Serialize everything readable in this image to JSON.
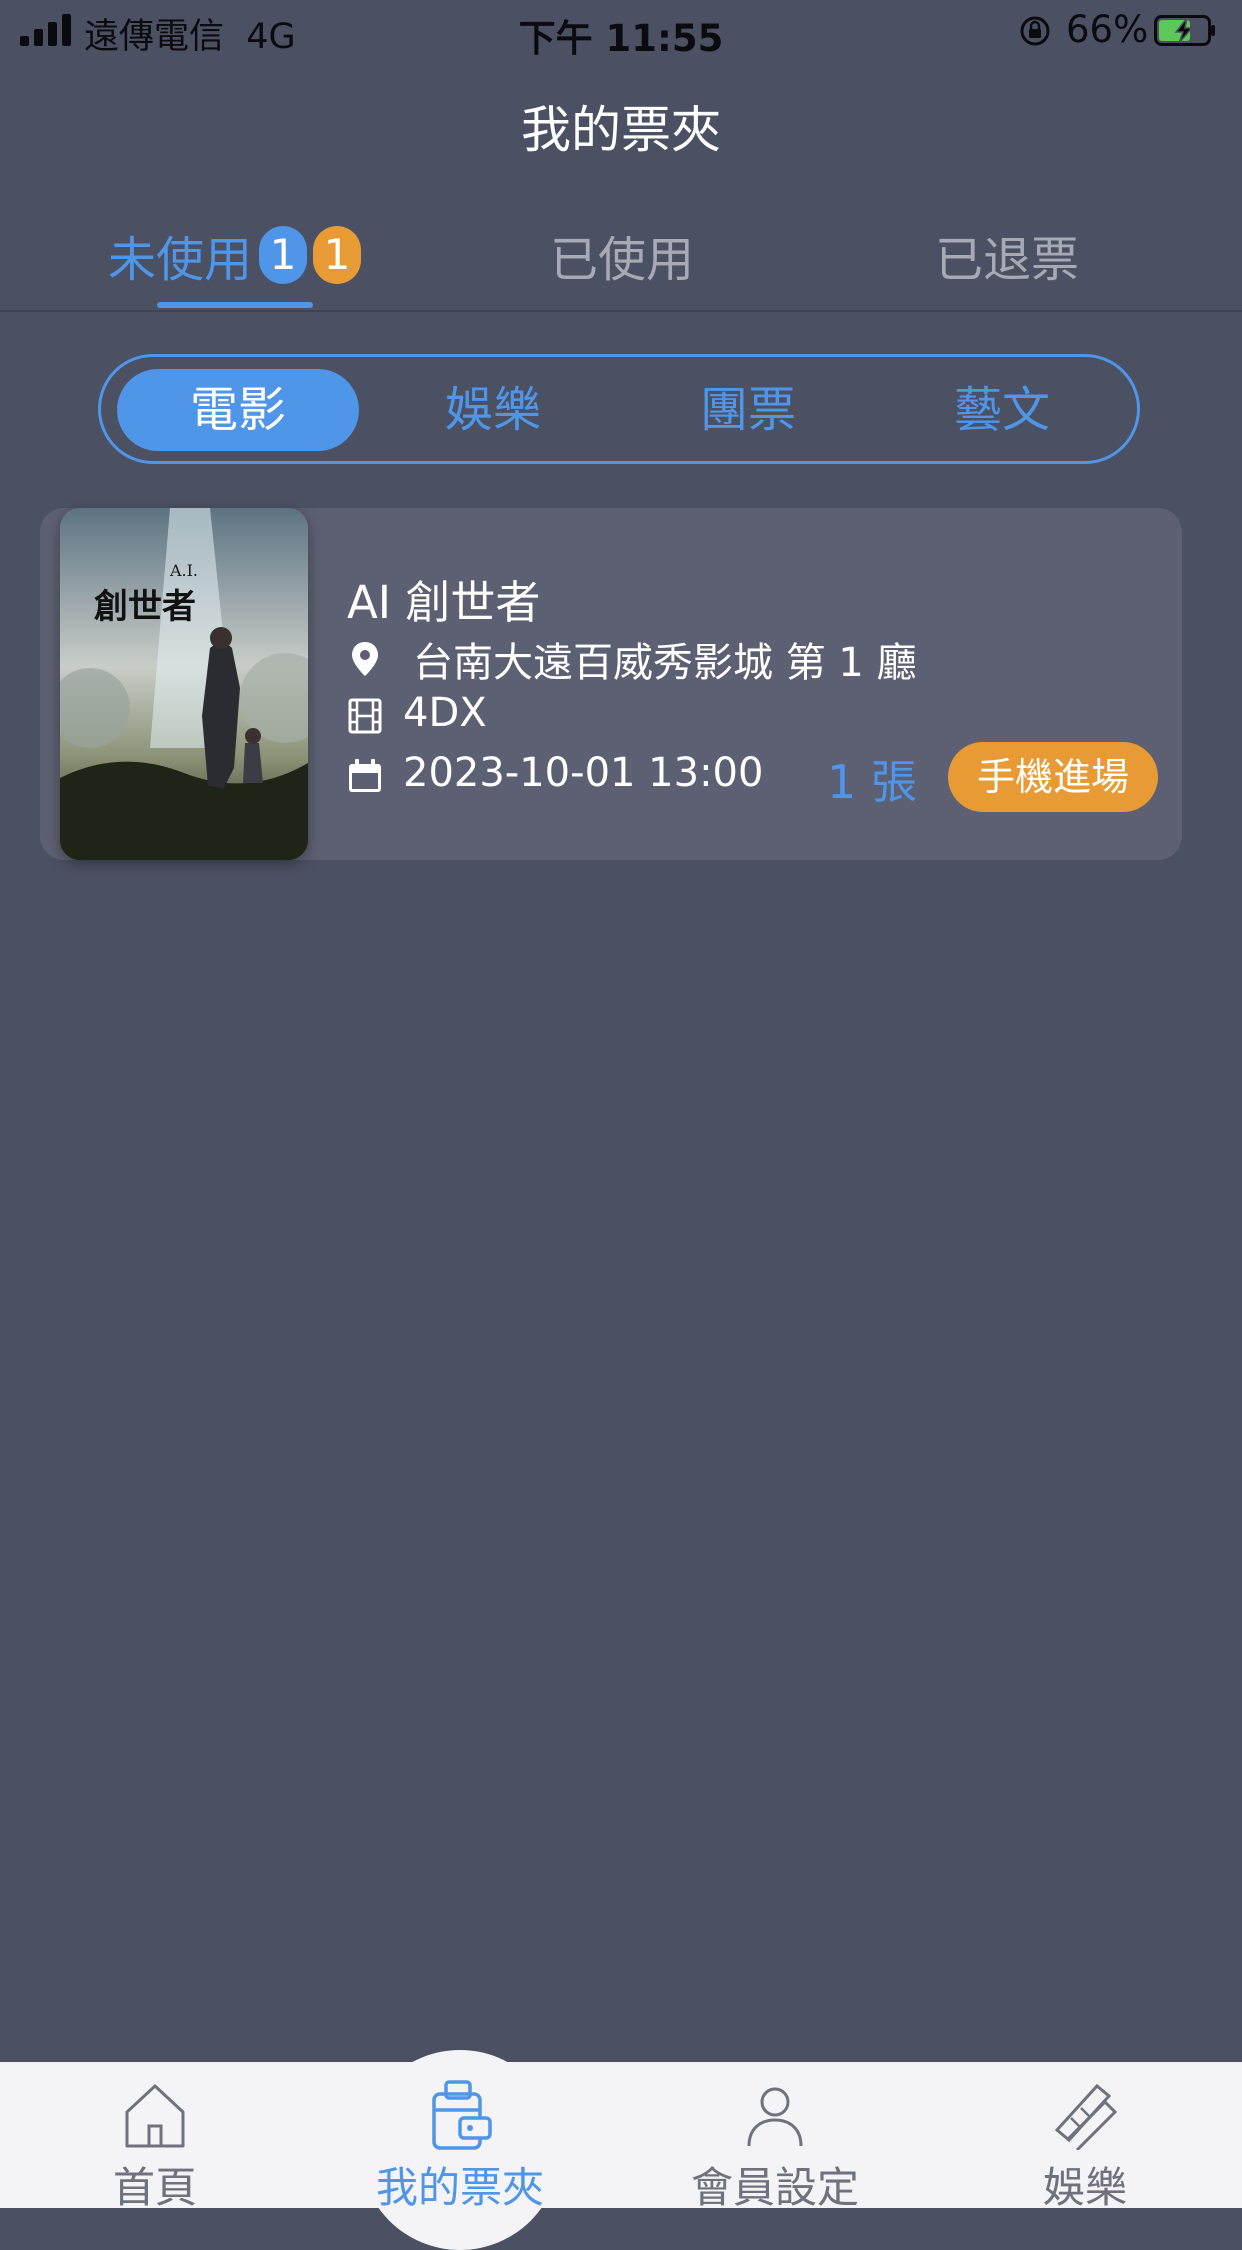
{
  "status_bar": {
    "carrier": "遠傳電信",
    "network": "4G",
    "time": "下午 11:55",
    "battery_percent": "66%",
    "battery_level": 0.66
  },
  "header": {
    "title": "我的票夾"
  },
  "tabs": [
    {
      "label": "未使用",
      "active": true,
      "badges": [
        "1",
        "1"
      ]
    },
    {
      "label": "已使用",
      "active": false
    },
    {
      "label": "已退票",
      "active": false
    }
  ],
  "categories": [
    {
      "label": "電影",
      "active": true
    },
    {
      "label": "娛樂",
      "active": false
    },
    {
      "label": "團票",
      "active": false
    },
    {
      "label": "藝文",
      "active": false
    }
  ],
  "tickets": [
    {
      "title": "AI 創世者",
      "poster_text": {
        "small": "A.I.",
        "big": "創世者"
      },
      "venue": "台南大遠百威秀影城 第 1 廳",
      "format": "4DX",
      "datetime": "2023-10-01 13:00",
      "count_label": "1 張",
      "action_label": "手機進場"
    }
  ],
  "bottom_nav": [
    {
      "label": "首頁",
      "icon": "home-icon",
      "active": false
    },
    {
      "label": "我的票夾",
      "icon": "wallet-icon",
      "active": true
    },
    {
      "label": "會員設定",
      "icon": "person-icon",
      "active": false
    },
    {
      "label": "娛樂",
      "icon": "entertainment-icon",
      "active": false
    }
  ],
  "colors": {
    "background": "#4c5063",
    "accent_blue": "#4f95e8",
    "accent_orange": "#e89b34",
    "card": "#5d6072"
  }
}
